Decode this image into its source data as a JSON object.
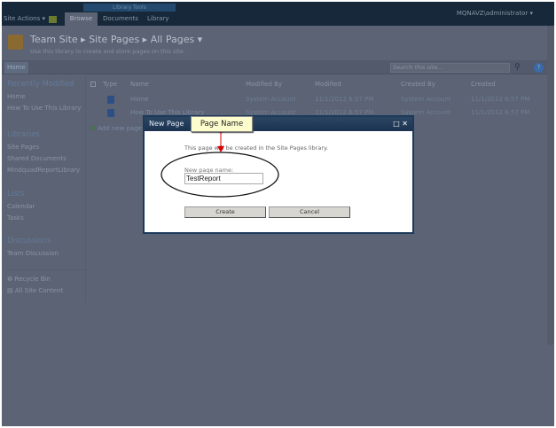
{
  "ribbon": {
    "library_tools": "Library Tools",
    "site_actions": "Site Actions ▾",
    "tabs": [
      "Browse",
      "Documents",
      "Library"
    ],
    "user": "MQNAVZ\\administrator ▾"
  },
  "header": {
    "breadcrumb": "Team Site ▸ Site Pages ▸ All Pages ▾",
    "description": "Use this library to create and store pages on this site."
  },
  "nav": {
    "home": "Home",
    "search_placeholder": "Search this site...",
    "help": "?"
  },
  "leftnav": {
    "recent": "Recently Modified",
    "recent_items": [
      "Home",
      "How To Use This Library"
    ],
    "libraries": "Libraries",
    "library_items": [
      "Site Pages",
      "Shared Documents",
      "MindquadReportLibrary"
    ],
    "lists": "Lists",
    "list_items": [
      "Calendar",
      "Tasks"
    ],
    "discussions": "Discussions",
    "discussion_items": [
      "Team Discussion"
    ],
    "recycle": "Recycle Bin",
    "all_content": "All Site Content"
  },
  "table": {
    "headers": [
      "Type",
      "Name",
      "Modified By",
      "Modified",
      "Created By",
      "Created"
    ],
    "rows": [
      {
        "name": "Home",
        "modified_by": "System Account",
        "modified": "11/1/2012 6:57 PM",
        "created_by": "System Account",
        "created": "11/1/2012 6:57 PM"
      },
      {
        "name": "How To Use This Library",
        "modified_by": "System Account",
        "modified": "11/1/2012 6:57 PM",
        "created_by": "System Account",
        "created": "11/1/2012 6:57 PM"
      }
    ],
    "add_new": "Add new page"
  },
  "dialog": {
    "title": "New Page",
    "message": "This page will be created in the Site Pages library.",
    "label": "New page name:",
    "value": "TestReport",
    "create": "Create",
    "cancel": "Cancel",
    "maximize": "□",
    "close": "✕"
  },
  "callout": {
    "label": "Page Name"
  }
}
